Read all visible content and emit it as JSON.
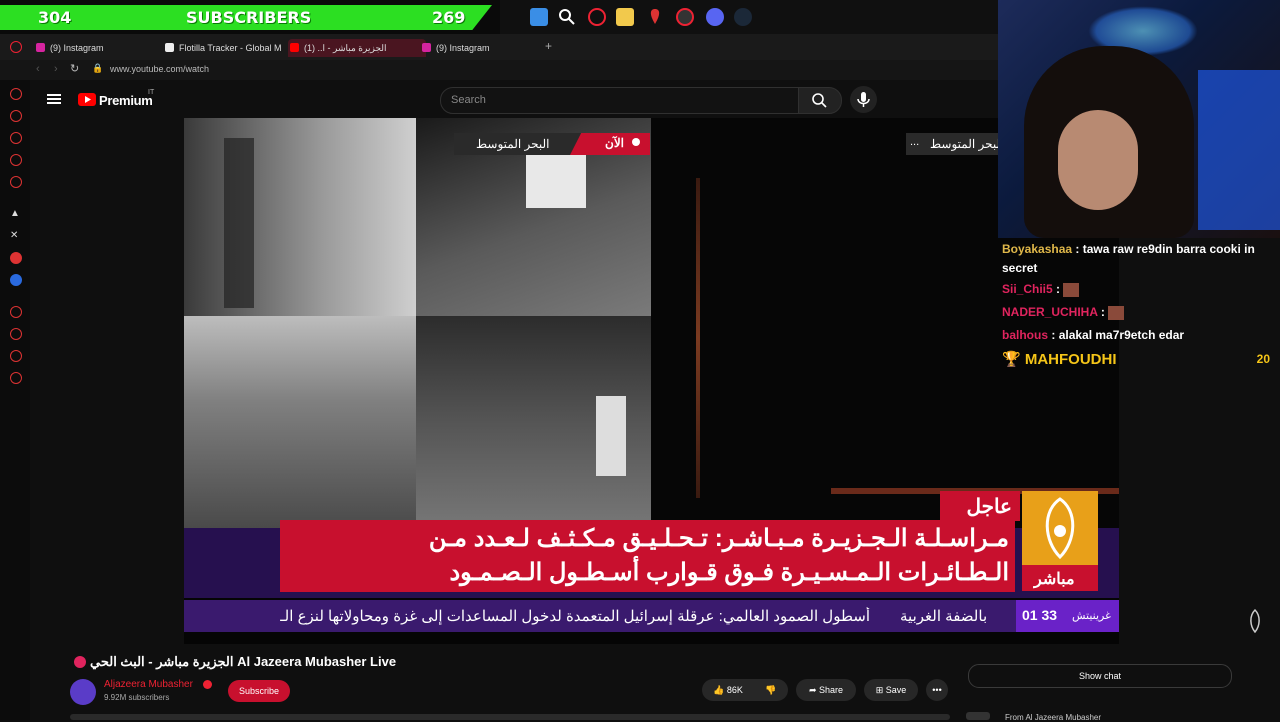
{
  "subbar": {
    "left_count": "304",
    "label": "SUBSCRIBERS",
    "right_count": "269"
  },
  "browser": {
    "tabs": [
      {
        "label": "(9) Instagram"
      },
      {
        "label": "Flotilla Tracker - Global M"
      },
      {
        "label": "الجزيرة مباشر - ا..  (1)"
      },
      {
        "label": "(9) Instagram"
      }
    ],
    "add_tab": "+",
    "url": "www.youtube.com/watch"
  },
  "youtube": {
    "brand": "Premium",
    "brand_sup": "IT",
    "search_placeholder": "Search"
  },
  "video": {
    "live_badge": "الآن",
    "location_label": "البحر المتوسط",
    "location_label_right": "لبحر المتوسط",
    "breaking_tag": "عاجل",
    "headline_line1": "مـراسـلـة الـجـزيـرة مـبـاشـر: تـحـلـيـق مـكـثـف لـعـدد مـن",
    "headline_line2": "الـطـائـرات الـمـسـيـرة فـوق قـوارب أسـطـول الـصـمـود",
    "ticker_text": "أسطول الصمود العالمي: عرقلة إسرائيل المتعمدة لدخول المساعدات إلى غزة ومحاولاتها لنزع الـ",
    "ticker_section": "بالضفة الغربية",
    "ticker_time": "01 33",
    "ticker_zone": "غرينيتش",
    "logo_text": "مباشر",
    "dots": "..."
  },
  "chat": [
    {
      "user": "Boyakashaa",
      "msg": ": tawa raw re9din barra cooki in secret",
      "color": "#e0b84a"
    },
    {
      "user": "Sii_Chii5",
      "msg": ":",
      "color": "#e0245e"
    },
    {
      "user": "NADER_UCHIHA",
      "msg": ":",
      "color": "#e0245e"
    },
    {
      "user": "balhous",
      "msg": ": alakal ma7r9etch edar",
      "color": "#e0245e"
    }
  ],
  "leader": {
    "name": "MAHFOUDHI",
    "score": "20"
  },
  "below": {
    "title": "الجزيرة مباشر - البث الحي Al Jazeera Mubasher Live",
    "channel": "Aljazeera Mubasher",
    "subs": "9.92M subscribers",
    "subscribe": "Subscribe",
    "likes": "86K",
    "share": "Share",
    "save": "Save",
    "more": "•••",
    "show_chat": "Show chat",
    "from_text": "From Al Jazeera Mubasher"
  },
  "colors": {
    "accent_red": "#c8102e",
    "sub_green": "#2cdf22",
    "ticker_purple": "#3a1a6e"
  }
}
